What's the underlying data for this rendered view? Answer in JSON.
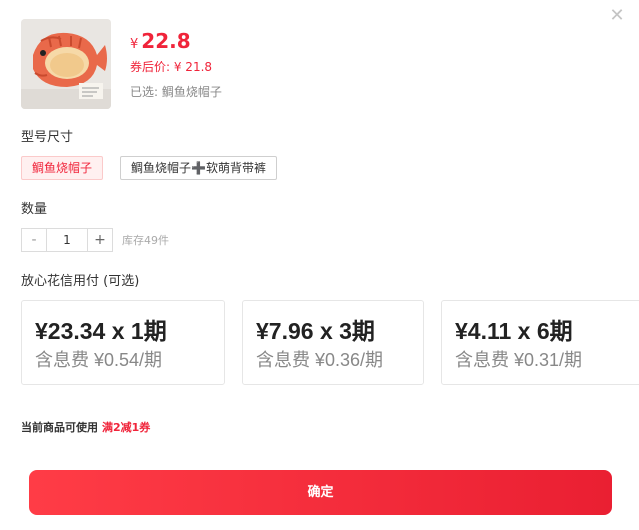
{
  "close_icon": "close-icon",
  "product": {
    "price_currency": "¥",
    "price": "22.8",
    "coupon_price": "券后价: ¥ 21.8",
    "selected_text": "已选: 鲷鱼烧帽子"
  },
  "spec": {
    "label": "型号尺寸",
    "options": [
      "鲷鱼烧帽子",
      "鲷鱼烧帽子➕软萌背带裤"
    ],
    "selected_index": 0
  },
  "quantity": {
    "label": "数量",
    "minus": "-",
    "value": "1",
    "plus": "+",
    "stock": "库存49件"
  },
  "installment": {
    "label": "放心花信用付 (可选)",
    "plans": [
      {
        "main": "¥23.34 x 1期",
        "fee": "含息费 ¥0.54/期"
      },
      {
        "main": "¥7.96 x 3期",
        "fee": "含息费 ¥0.36/期"
      },
      {
        "main": "¥4.11 x 6期",
        "fee": "含息费 ¥0.31/期"
      }
    ]
  },
  "coupon": {
    "text": "当前商品可使用",
    "highlight": "满2减1券"
  },
  "confirm_label": "确定",
  "colors": {
    "accent": "#f0243a",
    "button_start": "#ff3c46",
    "button_end": "#ea1f32"
  }
}
